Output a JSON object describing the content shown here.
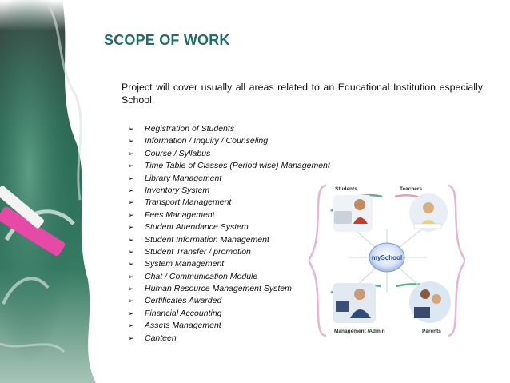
{
  "slide": {
    "title": "SCOPE OF WORK",
    "intro": "Project will cover usually all areas related to an Educational Institution especially School.",
    "items": [
      "Registration of Students",
      "Information / Inquiry / Counseling",
      "Course / Syllabus",
      "Time Table of Classes (Period wise) Management",
      "Library Management",
      "Inventory System",
      "Transport Management",
      "Fees Management",
      "Student Attendance System",
      "Student Information Management",
      "Student Transfer / promotion",
      "System Management",
      "Chat / Communication Module",
      "Human Resource Management System",
      "Certificates Awarded",
      "Financial Accounting",
      "Assets Management",
      "Canteen"
    ],
    "bullet_glyph": "➢"
  },
  "diagram": {
    "center": "mySchool",
    "students": "Students",
    "teachers": "Teachers",
    "management": "Management /Admin",
    "parents": "Parents"
  },
  "colors": {
    "title": "#1e6f6a",
    "chalkboard": "#2c6a55",
    "bracket": "#e7b7cf",
    "arc_green": "#5fae8a",
    "center_blue": "#1e4aa0"
  }
}
